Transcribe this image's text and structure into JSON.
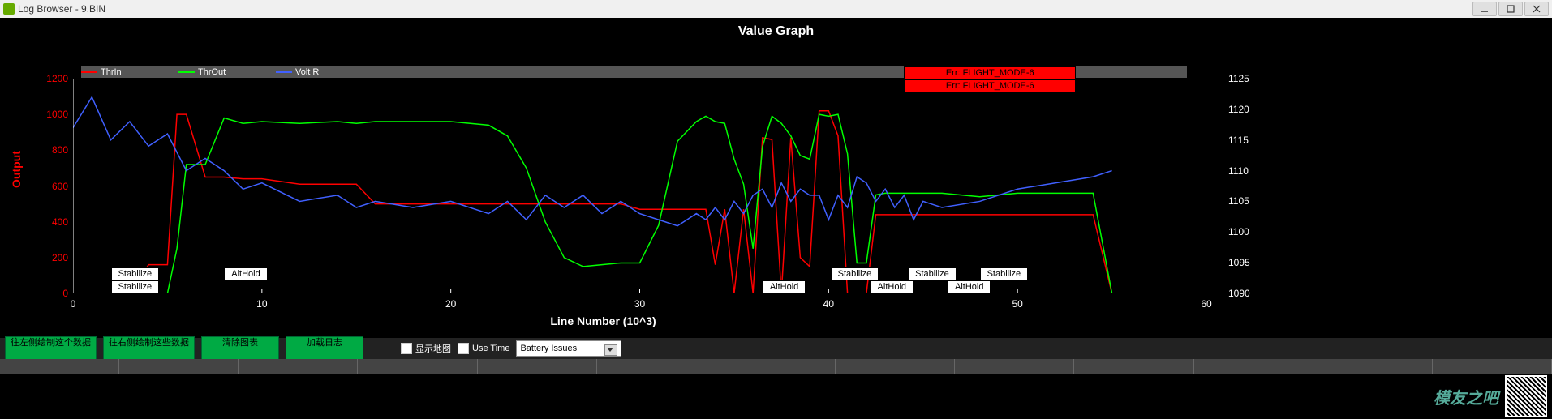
{
  "window": {
    "title": "Log Browser - 9.BIN"
  },
  "chart": {
    "title": "Value Graph",
    "xlabel": "Line Number (10^3)",
    "ylabel": "Output"
  },
  "legend": [
    {
      "name": "ThrIn",
      "color": "#ff0000"
    },
    {
      "name": "ThrOut",
      "color": "#00ff00"
    },
    {
      "name": "Volt R",
      "color": "#4060ff"
    }
  ],
  "yticks_left": [
    0,
    200,
    400,
    600,
    800,
    1000,
    1200
  ],
  "yticks_right": [
    1090,
    1095,
    1100,
    1105,
    1110,
    1115,
    1120,
    1125
  ],
  "xticks": [
    0,
    10,
    20,
    30,
    40,
    50,
    60
  ],
  "errors": [
    {
      "x": 44,
      "w": 9,
      "row": 0,
      "text": "Err: FLIGHT_MODE-6"
    },
    {
      "x": 44,
      "w": 9,
      "row": 1,
      "text": "Err: FLIGHT_MODE-6"
    }
  ],
  "modes": [
    {
      "x": 2.0,
      "text": "Stabilize",
      "row": 0
    },
    {
      "x": 2.0,
      "text": "Stabilize",
      "row": 1
    },
    {
      "x": 8.0,
      "text": "AltHold",
      "row": 0
    },
    {
      "x": 36.5,
      "text": "AltHold",
      "row": 1
    },
    {
      "x": 40.1,
      "text": "Stabilize",
      "row": 0
    },
    {
      "x": 42.2,
      "text": "AltHold",
      "row": 1
    },
    {
      "x": 44.2,
      "text": "Stabilize",
      "row": 0
    },
    {
      "x": 46.3,
      "text": "AltHold",
      "row": 1
    },
    {
      "x": 48.0,
      "text": "Stabilize",
      "row": 0
    }
  ],
  "toolbar": {
    "btn_left": "往左侧绘制这个数据",
    "btn_right": "往右侧绘制这些数据",
    "btn_clear": "清除图表",
    "btn_load": "加载日志",
    "cb_map": "显示地图",
    "cb_time": "Use Time",
    "dd_value": "Battery Issues"
  },
  "watermark": "模友之吧",
  "chart_data": {
    "type": "line",
    "xlabel": "Line Number (10^3)",
    "ylabel_left": "Output",
    "xlim": [
      0,
      60
    ],
    "ylim_left": [
      0,
      1200
    ],
    "ylim_right": [
      1090,
      1125
    ],
    "x": [
      0,
      1,
      2,
      3,
      4,
      5,
      5.5,
      6,
      7,
      8,
      9,
      10,
      12,
      14,
      15,
      16,
      18,
      20,
      22,
      23,
      24,
      25,
      26,
      27,
      28,
      29,
      30,
      31,
      32,
      33,
      33.5,
      34,
      34.5,
      35,
      35.5,
      36,
      36.5,
      37,
      37.5,
      38,
      38.5,
      39,
      39.5,
      40,
      40.5,
      41,
      41.5,
      42,
      42.5,
      43,
      43.5,
      44,
      44.5,
      45,
      46,
      48,
      50,
      52,
      54,
      55
    ],
    "series": [
      {
        "name": "ThrIn",
        "axis": "left",
        "color": "#ff0000",
        "values": [
          0,
          0,
          0,
          0,
          160,
          160,
          1000,
          1000,
          650,
          650,
          640,
          640,
          610,
          610,
          610,
          500,
          500,
          500,
          500,
          500,
          500,
          500,
          500,
          500,
          500,
          500,
          470,
          470,
          470,
          470,
          470,
          160,
          470,
          0,
          470,
          0,
          870,
          860,
          0,
          870,
          200,
          150,
          1020,
          1020,
          880,
          0,
          0,
          0,
          440,
          440,
          440,
          440,
          440,
          440,
          440,
          440,
          440,
          440,
          440,
          0
        ]
      },
      {
        "name": "ThrOut",
        "axis": "left",
        "color": "#00ff00",
        "values": [
          0,
          0,
          0,
          0,
          0,
          0,
          250,
          720,
          720,
          980,
          950,
          960,
          950,
          960,
          950,
          960,
          960,
          960,
          940,
          880,
          700,
          400,
          200,
          150,
          160,
          170,
          170,
          380,
          850,
          960,
          990,
          960,
          950,
          750,
          610,
          250,
          820,
          990,
          950,
          880,
          770,
          750,
          1000,
          990,
          1000,
          780,
          170,
          170,
          550,
          560,
          560,
          560,
          560,
          560,
          560,
          540,
          560,
          560,
          560,
          0
        ]
      },
      {
        "name": "Volt R",
        "axis": "right",
        "color": "#4060ff",
        "values": [
          1117,
          1122,
          1115,
          1118,
          1114,
          1116,
          1113,
          1110,
          1112,
          1110,
          1107,
          1108,
          1105,
          1106,
          1104,
          1105,
          1104,
          1105,
          1103,
          1105,
          1102,
          1106,
          1104,
          1106,
          1103,
          1105,
          1103,
          1102,
          1101,
          1103,
          1102,
          1104,
          1102,
          1105,
          1103,
          1106,
          1107,
          1104,
          1108,
          1105,
          1107,
          1106,
          1106,
          1102,
          1106,
          1104,
          1109,
          1108,
          1105,
          1107,
          1104,
          1106,
          1102,
          1105,
          1104,
          1105,
          1107,
          1108,
          1109,
          1110
        ]
      }
    ]
  }
}
